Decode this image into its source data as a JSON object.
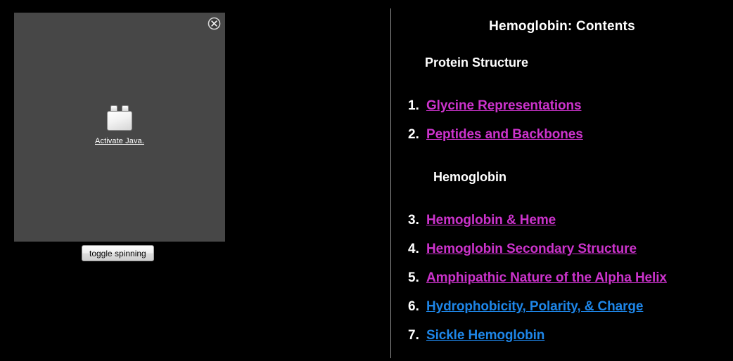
{
  "applet": {
    "icon_name": "java-plugin-brick-icon",
    "activate_label": "Activate Java.",
    "close_icon": "close-circle-icon",
    "background_color": "#474747"
  },
  "controls": {
    "toggle_spinning_label": "toggle spinning"
  },
  "contents": {
    "title": "Hemoglobin: Contents",
    "sections": [
      {
        "heading": "Protein Structure"
      },
      {
        "heading": "Hemoglobin"
      }
    ],
    "items": [
      {
        "marker": "1.",
        "label": "Glycine Representations",
        "state": "visited"
      },
      {
        "marker": "2.",
        "label": "Peptides and Backbones",
        "state": "visited"
      },
      {
        "marker": "3.",
        "label": "Hemoglobin & Heme",
        "state": "visited"
      },
      {
        "marker": "4.",
        "label": "Hemoglobin Secondary Structure",
        "state": "visited"
      },
      {
        "marker": "5.",
        "label": "Amphipathic Nature of the Alpha Helix",
        "state": "visited"
      },
      {
        "marker": "6.",
        "label": "Hydrophobicity, Polarity, & Charge",
        "state": "unvisited"
      },
      {
        "marker": "7.",
        "label": "Sickle Hemoglobin",
        "state": "unvisited"
      }
    ]
  },
  "colors": {
    "page_background": "#000000",
    "visited_link": "#cc33cc",
    "unvisited_link": "#1e86e8",
    "text": "#ffffff",
    "divider": "#8f8f8f"
  }
}
